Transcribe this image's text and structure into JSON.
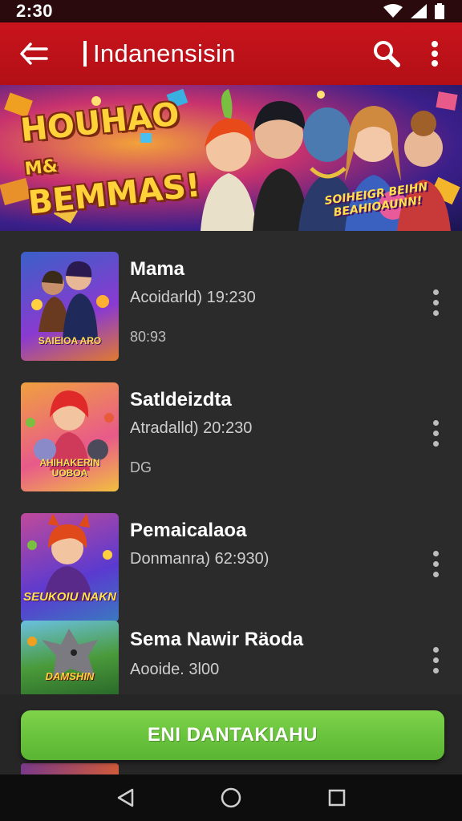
{
  "status": {
    "time": "2:30"
  },
  "app_bar": {
    "title": "Indanensisin"
  },
  "banner": {
    "title_line1": "HOUHAO",
    "title_amp": "M&",
    "title_line2": "BEMMAS!",
    "subtitle": "SOIHEIGR BEIHN BEAHIOAUNN!"
  },
  "items": [
    {
      "title": "Mama",
      "subtitle": "Acoidarld) 19:230",
      "meta": "80:93",
      "thumb_label": "SAIEIOA ARO"
    },
    {
      "title": "Satldeizdta",
      "subtitle": "Atradalld) 20:230",
      "meta": "DG",
      "thumb_label": "AHIHAKERIN UOBOA"
    },
    {
      "title": "Pemaicalaoa",
      "subtitle": "Donmanra) 62:930)",
      "meta": "",
      "thumb_label": "SEUKOIU NAKN"
    },
    {
      "title": "Sema Nawir Räoda",
      "subtitle": "Aooide. 3l00",
      "meta": "",
      "thumb_label": "DAMSHIN"
    }
  ],
  "action": {
    "label": "ENI DANTAKIAHU"
  },
  "colors": {
    "app_bar": "#c8141c",
    "action": "#6cc43e",
    "background": "#2b2b2b"
  },
  "icons": [
    "back-arrow-icon",
    "search-icon",
    "more-vert-icon",
    "wifi-icon",
    "signal-icon",
    "battery-icon",
    "nav-back-icon",
    "nav-home-icon",
    "nav-recents-icon"
  ]
}
